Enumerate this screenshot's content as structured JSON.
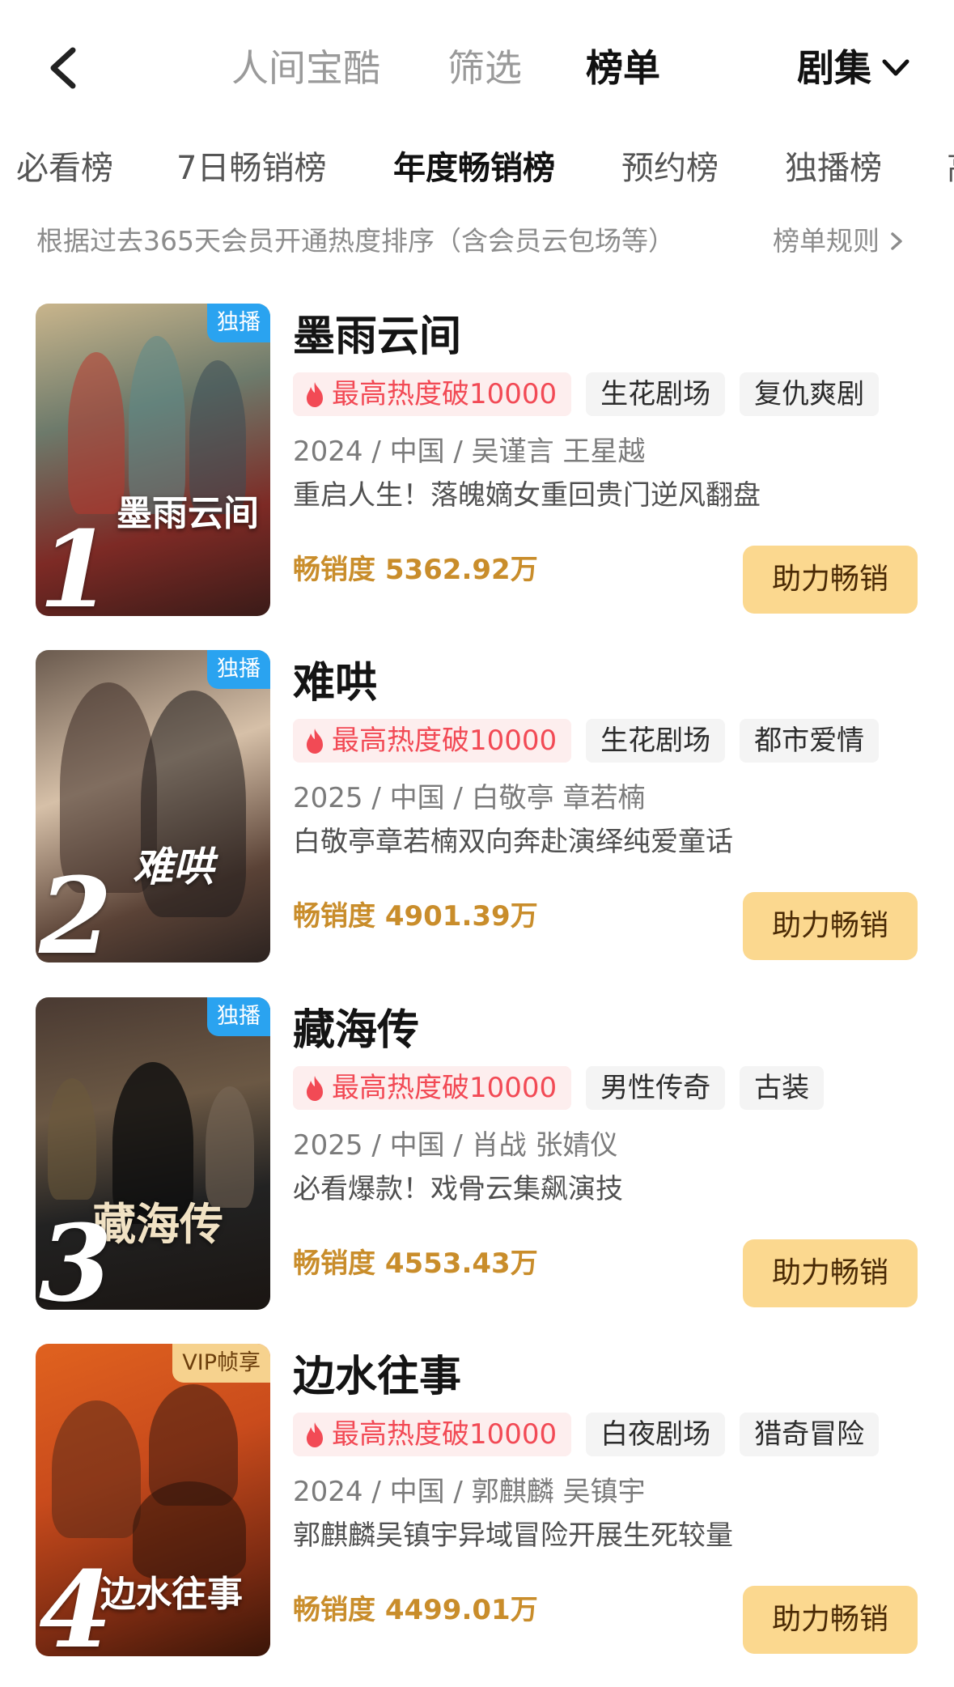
{
  "nav": {
    "tabs": [
      {
        "label": "人间宝酷",
        "active": false
      },
      {
        "label": "筛选",
        "active": false
      },
      {
        "label": "榜单",
        "active": true
      }
    ],
    "category": "剧集"
  },
  "sub_tabs": [
    {
      "label": "必看榜",
      "active": false
    },
    {
      "label": "7日畅销榜",
      "active": false
    },
    {
      "label": "年度畅销榜",
      "active": true
    },
    {
      "label": "预约榜",
      "active": false
    },
    {
      "label": "独播榜",
      "active": false
    },
    {
      "label": "高",
      "active": false
    }
  ],
  "description": "根据过去365天会员开通热度排序（含会员云包场等）",
  "rules_link": "榜单规则",
  "items": [
    {
      "rank": "1",
      "badge": "独播",
      "badge_type": "exclusive",
      "poster_art": "墨雨云间",
      "title": "墨雨云间",
      "hot_tag": "最高热度破10000",
      "tags": [
        "生花剧场",
        "复仇爽剧"
      ],
      "meta": "2024 / 中国 / 吴谨言 王星越",
      "desc": "重启人生！落魄嫡女重回贵门逆风翻盘",
      "sales": "畅销度 5362.92万",
      "button": "助力畅销"
    },
    {
      "rank": "2",
      "badge": "独播",
      "badge_type": "exclusive",
      "poster_art": "难哄",
      "title": "难哄",
      "hot_tag": "最高热度破10000",
      "tags": [
        "生花剧场",
        "都市爱情"
      ],
      "meta": "2025 / 中国 / 白敬亭 章若楠",
      "desc": "白敬亭章若楠双向奔赴演绎纯爱童话",
      "sales": "畅销度 4901.39万",
      "button": "助力畅销"
    },
    {
      "rank": "3",
      "badge": "独播",
      "badge_type": "exclusive",
      "poster_art": "藏海传",
      "title": "藏海传",
      "hot_tag": "最高热度破10000",
      "tags": [
        "男性传奇",
        "古装"
      ],
      "meta": "2025 / 中国 / 肖战 张婧仪",
      "desc": "必看爆款！戏骨云集飙演技",
      "sales": "畅销度 4553.43万",
      "button": "助力畅销"
    },
    {
      "rank": "4",
      "badge": "VIP帧享",
      "badge_type": "vip",
      "poster_art": "边水往事",
      "title": "边水往事",
      "hot_tag": "最高热度破10000",
      "tags": [
        "白夜剧场",
        "猎奇冒险"
      ],
      "meta": "2024 / 中国 / 郭麒麟 吴镇宇",
      "desc": "郭麒麟吴镇宇异域冒险开展生死较量",
      "sales": "畅销度 4499.01万",
      "button": "助力畅销"
    }
  ],
  "colors": {
    "accent_gold": "#c98d2b",
    "button_bg": "#fbd88f",
    "hot_red": "#f24a55",
    "exclusive_blue": "#2aa3f0"
  },
  "icons": {
    "back": "chevron-left-icon",
    "dropdown": "chevron-down-icon",
    "rules": "chevron-right-icon",
    "hot": "flame-icon"
  }
}
